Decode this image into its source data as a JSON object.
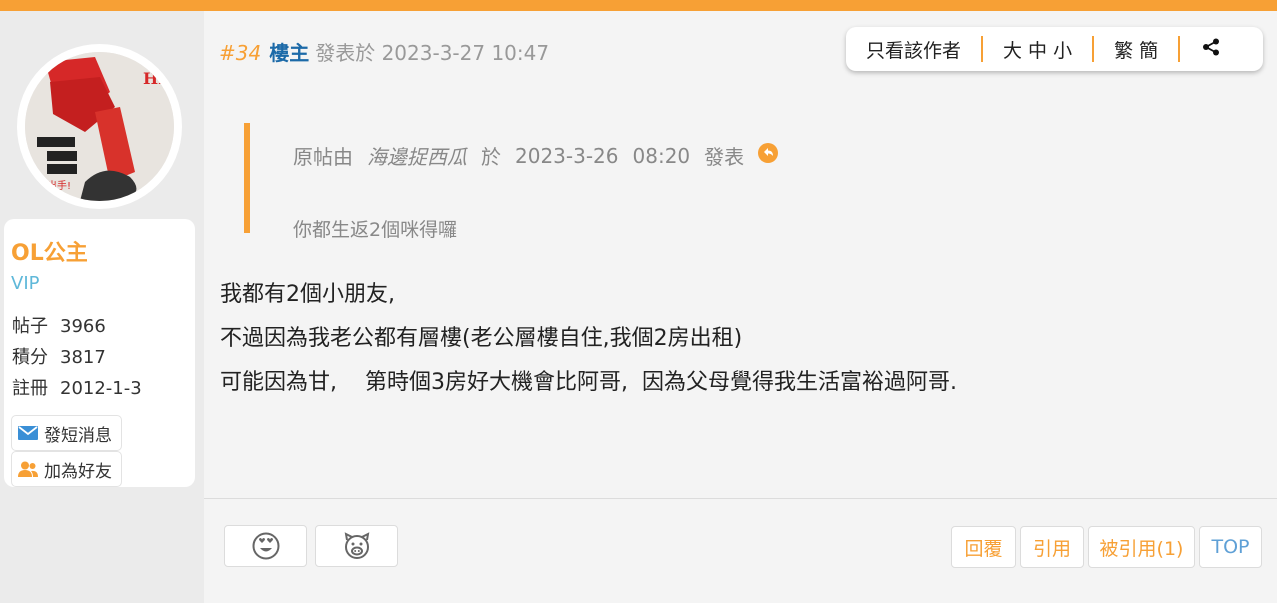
{
  "colors": {
    "accent": "#f7a035",
    "link_blue": "#1c6aa8",
    "vip": "#5fb8d9"
  },
  "user": {
    "avatar_text": "央出手!",
    "name": "OL公主",
    "group": "VIP",
    "stats": [
      {
        "label": "帖子",
        "value": "3966"
      },
      {
        "label": "積分",
        "value": "3817"
      },
      {
        "label": "註冊",
        "value": "2012-1-3"
      }
    ],
    "actions": [
      {
        "label": "發短消息",
        "icon": "mail-icon"
      },
      {
        "label": "加為好友",
        "icon": "add-friend-icon"
      }
    ]
  },
  "post": {
    "number": "#34",
    "op_badge": "樓主",
    "posted_prefix": "發表於",
    "timestamp": "2023-3-27 10:47",
    "tools": [
      "只看該作者",
      "大 中 小",
      "繁 簡"
    ],
    "quote": {
      "prefix": "原帖由",
      "author": "海邊捉西瓜",
      "at": "於",
      "date": "2023-3-26",
      "time": "08:20",
      "suffix": "發表",
      "body": "你都生返2個咪得囉"
    },
    "content": [
      "我都有2個小朋友,",
      "不過因為我老公都有層樓(老公層樓自住,我個2房出租)",
      "可能因為甘,    第時個3房好大機會比阿哥,  因為父母覺得我生活富裕過阿哥."
    ]
  },
  "actions": {
    "reply": "回覆",
    "quote": "引用",
    "quoted": "被引用(1)",
    "top": "TOP"
  }
}
